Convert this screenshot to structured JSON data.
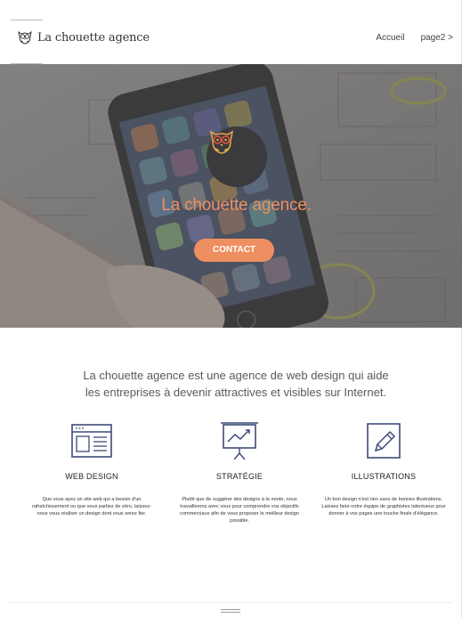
{
  "header": {
    "brand": "La chouette agence",
    "nav": [
      {
        "label": "Accueil"
      },
      {
        "label": "page2 >"
      }
    ]
  },
  "hero": {
    "title": "La chouette agence.",
    "cta": "CONTACT"
  },
  "intro": {
    "line1": "La chouette agence est une agence de web design qui aide",
    "line2": "les entreprises à devenir attractives et visibles sur Internet."
  },
  "services": [
    {
      "icon": "browser-layout-icon",
      "title": "WEB DESIGN",
      "text": "Que vous ayez un site web qui a besoin d'un rafraîchissement ou que vous partiez de zéro, laissez-nous vous réaliser un design dont vous serez fier."
    },
    {
      "icon": "presentation-chart-icon",
      "title": "STRATÉGIE",
      "text": "Plutôt que de suggérer des designs à la mode, nous travaillerons avec vous pour comprendre vos objectifs commerciaux afin de vous proposer le meilleur design possible."
    },
    {
      "icon": "pencil-icon",
      "title": "ILLUSTRATIONS",
      "text": "Un bon design n'est rien sans de bonnes illustrations. Laissez faire notre équipe de graphistes talentueux pour donner à vos pages une touche finale d'élégance."
    }
  ],
  "colors": {
    "accent": "#ee8f61",
    "hero_overlay": "#7a7977",
    "owl_badge": "#3b3a3c"
  }
}
